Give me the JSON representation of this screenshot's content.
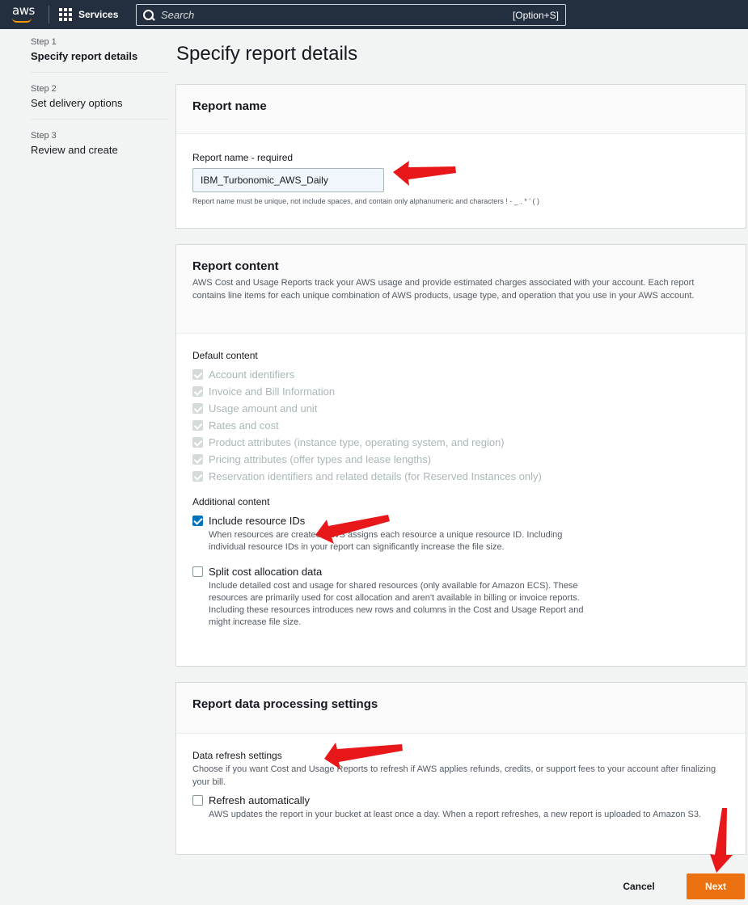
{
  "nav": {
    "logo_text": "aws",
    "services_label": "Services",
    "search_placeholder": "Search",
    "search_shortcut": "[Option+S]"
  },
  "steps": [
    {
      "number": "Step 1",
      "label": "Specify report details",
      "active": true
    },
    {
      "number": "Step 2",
      "label": "Set delivery options",
      "active": false
    },
    {
      "number": "Step 3",
      "label": "Review and create",
      "active": false
    }
  ],
  "page_title": "Specify report details",
  "report_name": {
    "title": "Report name",
    "field_label": "Report name - required",
    "value": "IBM_Turbonomic_AWS_Daily",
    "constraint": "Report name must be unique, not include spaces, and contain only alphanumeric and characters ! - _ . * ' ( )"
  },
  "report_content": {
    "title": "Report content",
    "description": "AWS Cost and Usage Reports track your AWS usage and provide estimated charges associated with your account. Each report contains line items for each unique combination of AWS products, usage type, and operation that you use in your AWS account.",
    "default_label": "Default content",
    "default_items": [
      "Account identifiers",
      "Invoice and Bill Information",
      "Usage amount and unit",
      "Rates and cost",
      "Product attributes (instance type, operating system, and region)",
      "Pricing attributes (offer types and lease lengths)",
      "Reservation identifiers and related details (for Reserved Instances only)"
    ],
    "additional_label": "Additional content",
    "resource_ids": {
      "label": "Include resource IDs",
      "checked": true,
      "description": "When resources are created, AWS assigns each resource a unique resource ID. Including individual resource IDs in your report can significantly increase the file size."
    },
    "split_cost": {
      "label": "Split cost allocation data",
      "checked": false,
      "description": "Include detailed cost and usage for shared resources (only available for Amazon ECS). These resources are primarily used for cost allocation and aren't available in billing or invoice reports. Including these resources introduces new rows and columns in the Cost and Usage Report and might increase file size."
    }
  },
  "processing": {
    "title": "Report data processing settings",
    "refresh_label": "Data refresh settings",
    "refresh_desc": "Choose if you want Cost and Usage Reports to refresh if AWS applies refunds, credits, or support fees to your account after finalizing your bill.",
    "auto_refresh": {
      "label": "Refresh automatically",
      "checked": false,
      "description": "AWS updates the report in your bucket at least once a day. When a report refreshes, a new report is uploaded to Amazon S3."
    }
  },
  "buttons": {
    "cancel": "Cancel",
    "next": "Next"
  },
  "colors": {
    "nav_bg": "#232f3e",
    "accent_orange": "#ec7211",
    "checkbox_blue": "#0073bb",
    "annotation_red": "#e8171a"
  }
}
